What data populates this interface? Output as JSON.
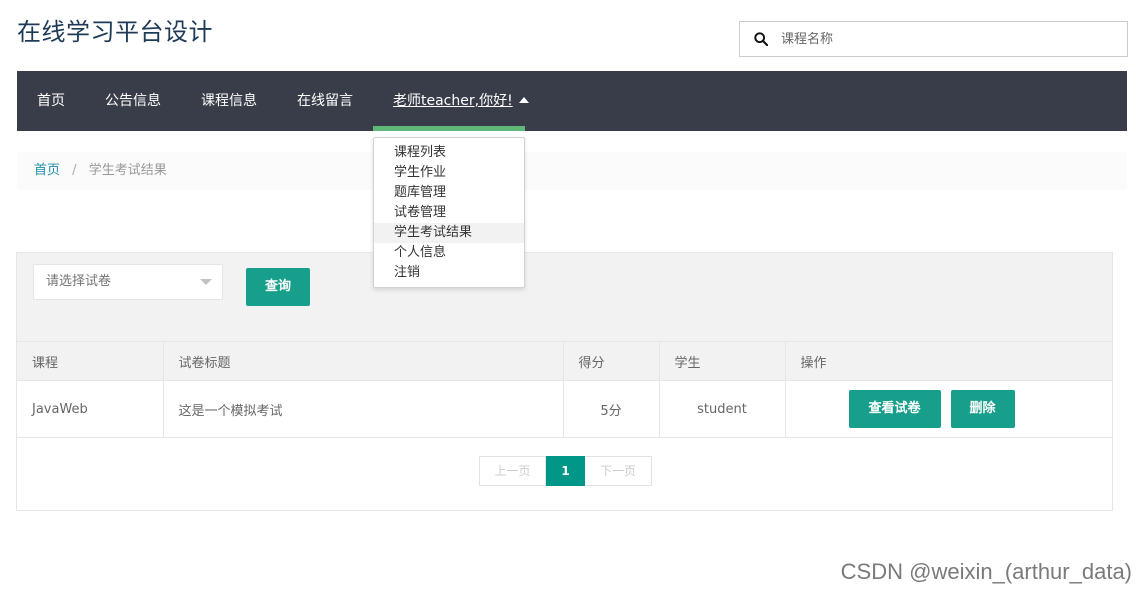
{
  "site": {
    "title": "在线学习平台设计"
  },
  "search": {
    "placeholder": "课程名称"
  },
  "nav": {
    "items": [
      "首页",
      "公告信息",
      "课程信息",
      "在线留言"
    ],
    "user_label": "老师teacher,你好!"
  },
  "dropdown": {
    "items": [
      "课程列表",
      "学生作业",
      "题库管理",
      "试卷管理",
      "学生考试结果",
      "个人信息",
      "注销"
    ],
    "active": "学生考试结果"
  },
  "breadcrumb": {
    "home": "首页",
    "separator": "/",
    "current": "学生考试结果"
  },
  "filter": {
    "select_placeholder": "请选择试卷",
    "query_label": "查询"
  },
  "table": {
    "headers": [
      "课程",
      "试卷标题",
      "得分",
      "学生",
      "操作"
    ],
    "rows": [
      {
        "course": "JavaWeb",
        "title": "这是一个模拟考试",
        "score": "5分",
        "student": "student"
      }
    ],
    "actions": {
      "view_label": "查看试卷",
      "delete_label": "删除"
    }
  },
  "pagination": {
    "prev": "上一页",
    "current": "1",
    "next": "下一页"
  },
  "watermark": "CSDN @weixin_(arthur_data)",
  "colors": {
    "primary": "#179f8b",
    "nav_bg": "#393d49",
    "nav_active": "#5fb878",
    "title": "#1d3a57"
  }
}
